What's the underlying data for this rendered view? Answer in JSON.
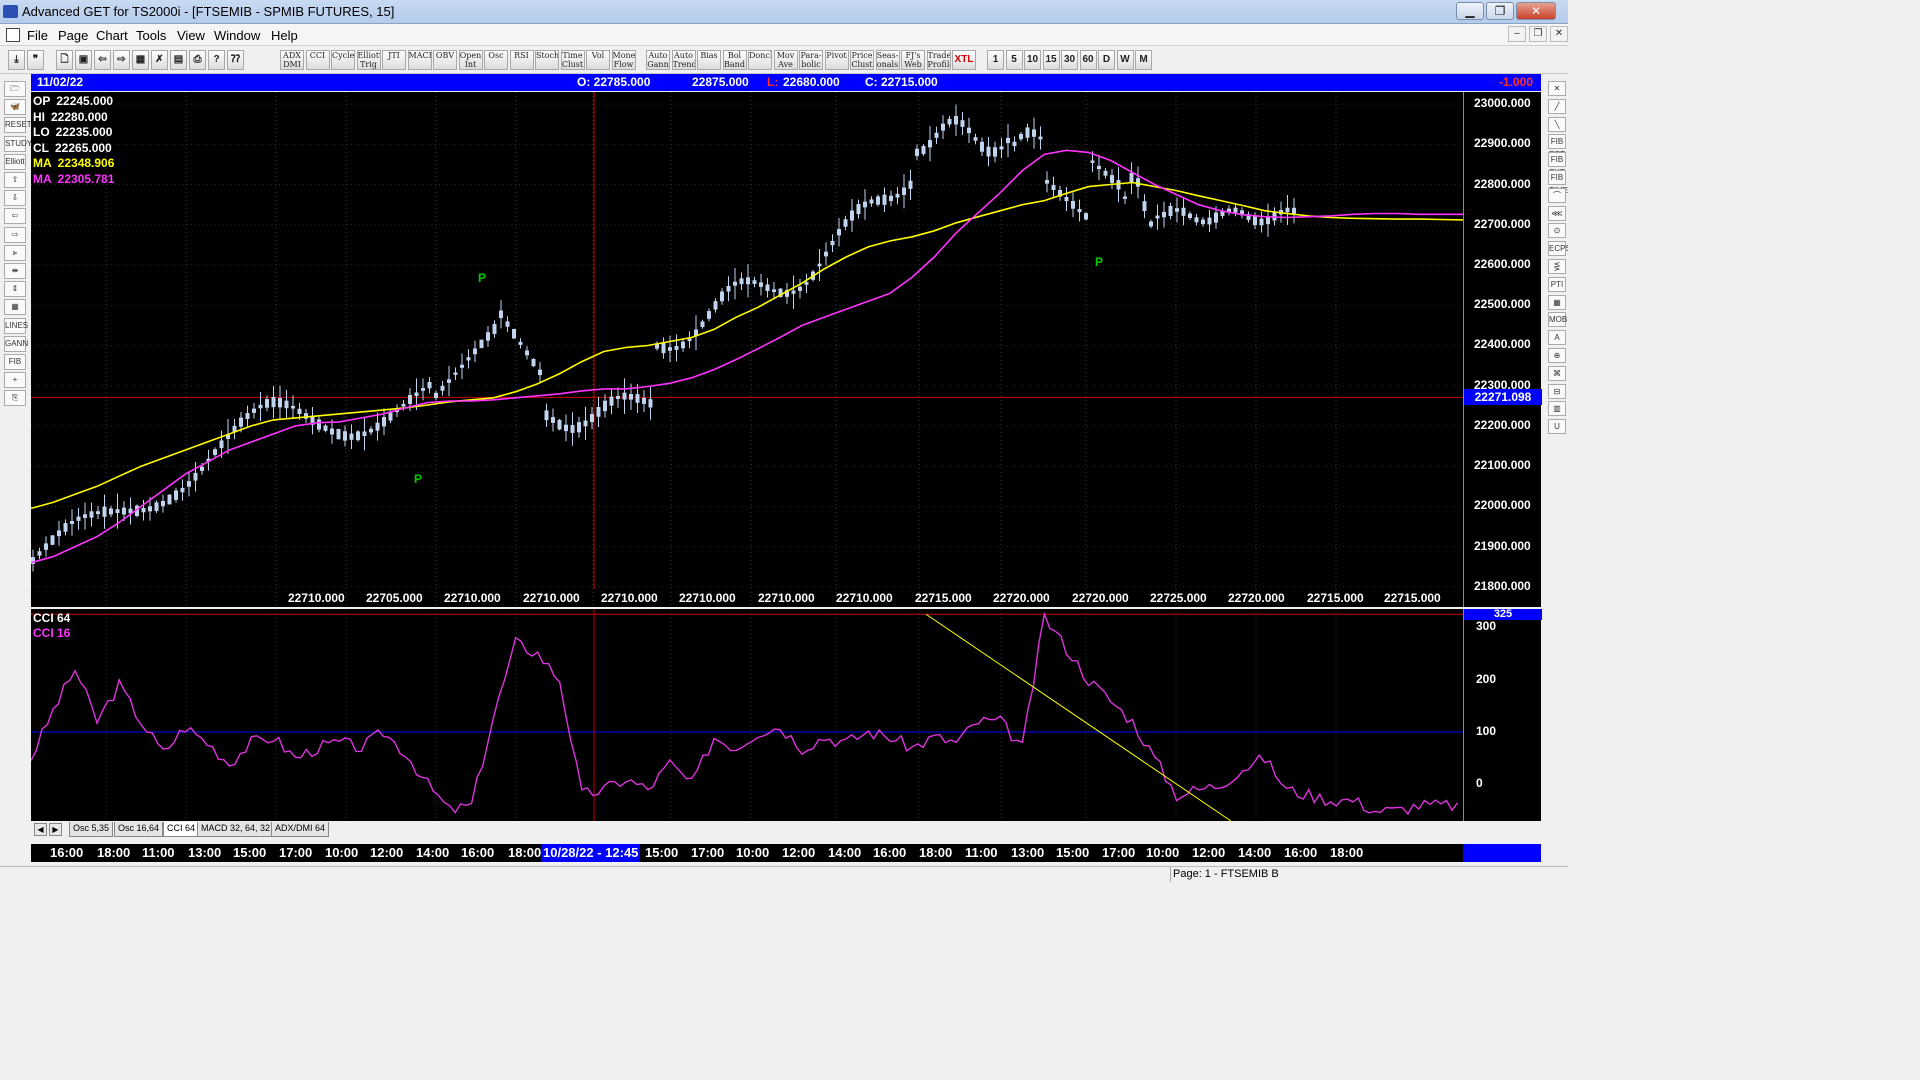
{
  "window": {
    "title": "Advanced GET for TS2000i - [FTSEMIB - SPMIB FUTURES, 15]",
    "min": "▁",
    "max": "❐",
    "close": "✕"
  },
  "menu": [
    "File",
    "Page",
    "Chart",
    "Tools",
    "View",
    "Window",
    "Help"
  ],
  "mdi_controls": [
    "–",
    "❐",
    "✕"
  ],
  "toolbar": {
    "file_icons": [
      "⤓",
      "❞",
      "🗋",
      "▣",
      "⇦",
      "⇨",
      "▦",
      "✗",
      "▤",
      "⎙",
      "?",
      "⁇"
    ],
    "studies": [
      "ADX DMI",
      "CCI",
      "Cycles",
      "Elliott Trig",
      "JTI",
      "MACD",
      "OBV",
      "Open Int",
      "Osc",
      "RSI",
      "Stoch",
      "Time Clust",
      "Vol",
      "Money Flow"
    ],
    "overlays": [
      "Auto Gann",
      "Auto Trend",
      "Bias",
      "Bol Band",
      "Donch",
      "Mov Ave",
      "Para-bolic",
      "Pivot",
      "Price Clust",
      "Seas-onals",
      "FJ's Web",
      "Trade Profile",
      "XTL"
    ],
    "intervals": [
      "1",
      "5",
      "10",
      "15",
      "30",
      "60",
      "D",
      "W",
      "M"
    ]
  },
  "left_tools": [
    "🗁",
    "🦋",
    "RESET",
    "STUDY",
    "Elliott",
    "⇧",
    "⇩",
    "⇦",
    "⇨",
    "⫸",
    "⇼",
    "⇕",
    "▦",
    "LINES",
    "GANN",
    "FIB",
    "+",
    "⎘"
  ],
  "right_tools": [
    "✕",
    "╱",
    "╲",
    "FIB RET",
    "FIB EXT",
    "FIB TIME",
    "⌒",
    "⋘",
    "⊙",
    "ECPS",
    "⋚",
    "PTI",
    "▦",
    "MOB",
    "A",
    "⊕",
    "⌘",
    "⊟",
    "▥",
    "U"
  ],
  "info_bar": {
    "date": "11/02/22",
    "open": "O: 22785.000",
    "high": "22875.000",
    "low_label": "L:",
    "low": "22680.000",
    "close": "C: 22715.000",
    "change": "-1.000"
  },
  "legend": [
    {
      "label": "OP",
      "value": "22245.000",
      "color": "#ffffff"
    },
    {
      "label": "HI",
      "value": "22280.000",
      "color": "#ffffff"
    },
    {
      "label": "LO",
      "value": "22235.000",
      "color": "#ffffff"
    },
    {
      "label": "CL",
      "value": "22265.000",
      "color": "#ffffff"
    },
    {
      "label": "MA",
      "value": "22348.906",
      "color": "#ffff00"
    },
    {
      "label": "MA",
      "value": "22305.781",
      "color": "#ff33ff"
    }
  ],
  "price_scale": {
    "ticks": [
      "23000.000",
      "22900.000",
      "22800.000",
      "22700.000",
      "22600.000",
      "22500.000",
      "22400.000",
      "22300.000",
      "22200.000",
      "22100.000",
      "22000.000",
      "21900.000",
      "21800.000"
    ],
    "last_price": "22271.098"
  },
  "pivot_marker": "P",
  "bottom_price_labels": [
    "22710.000",
    "22705.000",
    "22710.000",
    "22710.000",
    "22710.000",
    "22710.000",
    "22710.000",
    "22710.000",
    "22715.000",
    "22720.000",
    "22720.000",
    "22725.000",
    "22720.000",
    "22715.000"
  ],
  "bottom_price_last": "22715.000",
  "cci_panel": {
    "label1": "CCI 64",
    "label2": "CCI  16",
    "scale": [
      "300",
      "200",
      "100",
      "0"
    ],
    "top_value": "325"
  },
  "tabs": {
    "nav": [
      "◀",
      "▶"
    ],
    "items": [
      "Osc 5,35",
      "Osc 16,64",
      "CCI 64",
      "MACD 32, 64, 32",
      "ADX/DMI 64"
    ],
    "active": 2
  },
  "time_axis": {
    "labels": [
      "16:00",
      "18:00",
      "11:00",
      "13:00",
      "15:00",
      "17:00",
      "10:00",
      "12:00",
      "14:00",
      "16:00",
      "18:00"
    ],
    "highlight": "10/28/22 - 12:45",
    "labels_after": [
      "15:00",
      "17:00",
      "10:00",
      "12:00",
      "14:00",
      "16:00",
      "18:00",
      "11:00",
      "13:00",
      "15:00",
      "17:00",
      "10:00",
      "12:00",
      "14:00",
      "16:00",
      "18:00"
    ]
  },
  "status": {
    "page": "Page: 1 - FTSEMIB B"
  },
  "colors": {
    "ma_fast": "#ffff00",
    "ma_slow": "#ff33ff",
    "cursor": "#cc0000",
    "candle": "#c0d4f0",
    "pivot": "#00cc00"
  },
  "chart_data": {
    "type": "line",
    "title": "FTSEMIB - SPMIB FUTURES, 15",
    "ylim": [
      21750,
      23030
    ],
    "series": [
      {
        "name": "MA",
        "x": [
          0,
          20,
          40,
          60,
          80,
          100,
          120,
          140,
          160,
          180,
          200,
          220,
          240,
          260,
          280,
          300,
          320,
          340,
          360,
          380,
          400,
          420,
          440,
          460,
          480,
          500,
          520,
          540,
          560,
          580,
          600,
          620,
          640,
          660,
          680,
          700,
          720,
          740,
          760,
          780,
          800,
          820,
          840,
          860,
          880,
          900,
          920,
          940,
          960,
          980,
          1000,
          1020,
          1040,
          1060,
          1080,
          1100,
          1120,
          1140,
          1160,
          1180,
          1200,
          1220,
          1240,
          1260,
          1280,
          1300
        ],
        "values": [
          21995,
          22010,
          22030,
          22050,
          22075,
          22100,
          22120,
          22140,
          22160,
          22180,
          22200,
          22215,
          22220,
          22225,
          22230,
          22235,
          22240,
          22245,
          22252,
          22260,
          22265,
          22270,
          22285,
          22305,
          22330,
          22360,
          22385,
          22395,
          22400,
          22410,
          22420,
          22440,
          22470,
          22495,
          22525,
          22555,
          22590,
          22620,
          22645,
          22660,
          22670,
          22685,
          22705,
          22720,
          22735,
          22750,
          22760,
          22778,
          22795,
          22800,
          22805,
          22795,
          22785,
          22772,
          22760,
          22748,
          22735,
          22728,
          22722,
          22718,
          22716,
          22715,
          22714,
          22714,
          22713,
          22712
        ]
      },
      {
        "name": "MA",
        "x": [
          0,
          20,
          40,
          60,
          80,
          100,
          120,
          140,
          160,
          180,
          200,
          220,
          240,
          260,
          280,
          300,
          320,
          340,
          360,
          380,
          400,
          420,
          440,
          460,
          480,
          500,
          520,
          540,
          560,
          580,
          600,
          620,
          640,
          660,
          680,
          700,
          720,
          740,
          760,
          780,
          800,
          820,
          840,
          860,
          880,
          900,
          920,
          940,
          960,
          980,
          1000,
          1020,
          1040,
          1060,
          1080,
          1100,
          1120,
          1140,
          1160,
          1180,
          1200,
          1220,
          1240,
          1260,
          1280,
          1300
        ],
        "values": [
          21860,
          21875,
          21900,
          21925,
          21960,
          22000,
          22040,
          22080,
          22110,
          22140,
          22160,
          22180,
          22200,
          22208,
          22210,
          22220,
          22230,
          22245,
          22258,
          22262,
          22262,
          22265,
          22270,
          22275,
          22280,
          22287,
          22292,
          22292,
          22298,
          22306,
          22320,
          22340,
          22365,
          22392,
          22420,
          22450,
          22470,
          22490,
          22510,
          22530,
          22570,
          22620,
          22680,
          22730,
          22780,
          22835,
          22875,
          22885,
          22880,
          22860,
          22830,
          22800,
          22775,
          22750,
          22735,
          22725,
          22720,
          22718,
          22720,
          22722,
          22726,
          22728,
          22728,
          22726,
          22726,
          22726
        ]
      },
      {
        "name": "CCI 16",
        "x": [
          0,
          20,
          40,
          60,
          80,
          100,
          120,
          140,
          160,
          180,
          200,
          220,
          240,
          260,
          280,
          300,
          320,
          340,
          360,
          380,
          400,
          420,
          440,
          460,
          480,
          500,
          520,
          540,
          560,
          580,
          600,
          620,
          640,
          660,
          680,
          700,
          720,
          740,
          760,
          780,
          800,
          820,
          840,
          860,
          880,
          900,
          920,
          940,
          960,
          980,
          1000,
          1020,
          1040,
          1060,
          1080,
          1100,
          1120,
          1140,
          1160,
          1180,
          1200,
          1220,
          1240,
          1260,
          1280,
          1300
        ],
        "values": [
          50,
          140,
          220,
          120,
          190,
          120,
          60,
          110,
          80,
          40,
          80,
          90,
          50,
          70,
          80,
          70,
          100,
          60,
          0,
          -50,
          -40,
          130,
          270,
          250,
          200,
          -20,
          -10,
          10,
          -10,
          40,
          0,
          90,
          70,
          100,
          110,
          70,
          90,
          80,
          100,
          90,
          70,
          90,
          80,
          120,
          120,
          70,
          320,
          260,
          200,
          160,
          120,
          50,
          -20,
          -10,
          0,
          30,
          50,
          -10,
          -20,
          -30,
          -30,
          -50,
          -50,
          -40,
          -40,
          -40
        ]
      },
      {
        "name": "CCI 64",
        "x": [
          0,
          1300
        ],
        "values": [
          0,
          0
        ]
      }
    ]
  }
}
